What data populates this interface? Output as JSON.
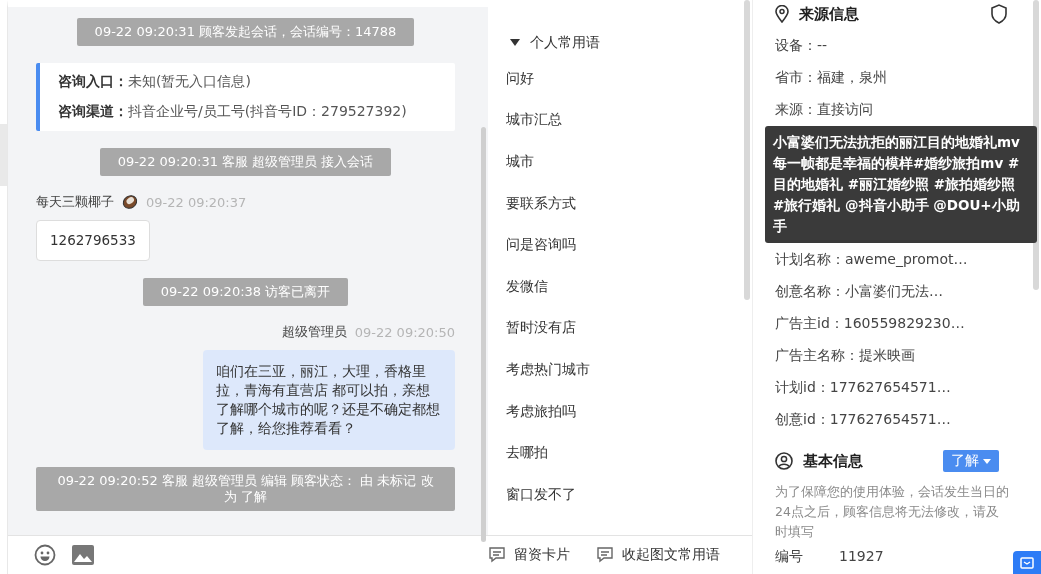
{
  "chat": {
    "messages": [
      {
        "kind": "system",
        "text": "09-22 09:20:31 顾客发起会话，会话编号：14788"
      },
      {
        "kind": "info",
        "rows": [
          {
            "label": "咨询入口：",
            "value": "未知(暂无入口信息)"
          },
          {
            "label": "咨询渠道：",
            "value": "抖音企业号/员工号(抖音号ID：279527392)"
          }
        ]
      },
      {
        "kind": "system",
        "text": "09-22 09:20:31 客服 超级管理员 接入会话"
      },
      {
        "kind": "visitor",
        "sender": "每天三颗椰子",
        "time": "09-22 09:20:37",
        "text": "1262796533"
      },
      {
        "kind": "system",
        "text": "09-22 09:20:38 访客已离开"
      },
      {
        "kind": "agent",
        "sender": "超级管理员",
        "time": "09-22 09:20:50",
        "text": "咱们在三亚，丽江，大理，香格里拉，青海有直营店 都可以拍，亲想了解哪个城市的呢？还是不确定都想了解，给您推荐看看？"
      },
      {
        "kind": "system",
        "text": "09-22 09:20:52 客服 超级管理员 编辑 顾客状态： 由 未标记 改为 了解"
      }
    ]
  },
  "phrases": {
    "group": {
      "label": "个人常用语",
      "expanded": true
    },
    "items": [
      "问好",
      "城市汇总",
      "城市",
      "要联系方式",
      "问是咨询吗",
      "发微信",
      "暂时没有店",
      "考虑热门城市",
      "考虑旅拍吗",
      "去哪拍",
      "窗口发不了"
    ],
    "footer": [
      "留资卡片",
      "收起图文常用语"
    ]
  },
  "source": {
    "title": "来源信息",
    "rows_before": [
      "设备：--",
      "省市：福建，泉州",
      "来源：直接访问"
    ],
    "rows_after": [
      "计划名称：aweme_promot…",
      "创意名称：小富婆们无法…",
      "广告主id：160559829230…",
      "广告主名称：提米映画",
      "计划id：177627654571…",
      "创意id：177627654571…"
    ],
    "tooltip": "小富婆们无法抗拒的丽江目的地婚礼mv 每一帧都是幸福的模样#婚纱旅拍mv #目的地婚礼 #丽江婚纱照 #旅拍婚纱照 #旅行婚礼 @抖音小助手 @DOU+小助手"
  },
  "basic": {
    "title": "基本信息",
    "status": "了解",
    "note": "为了保障您的使用体验，会话发生当日的24点之后，顾客信息将无法修改，请及时填写",
    "field": {
      "label": "编号",
      "value": "11927"
    }
  }
}
